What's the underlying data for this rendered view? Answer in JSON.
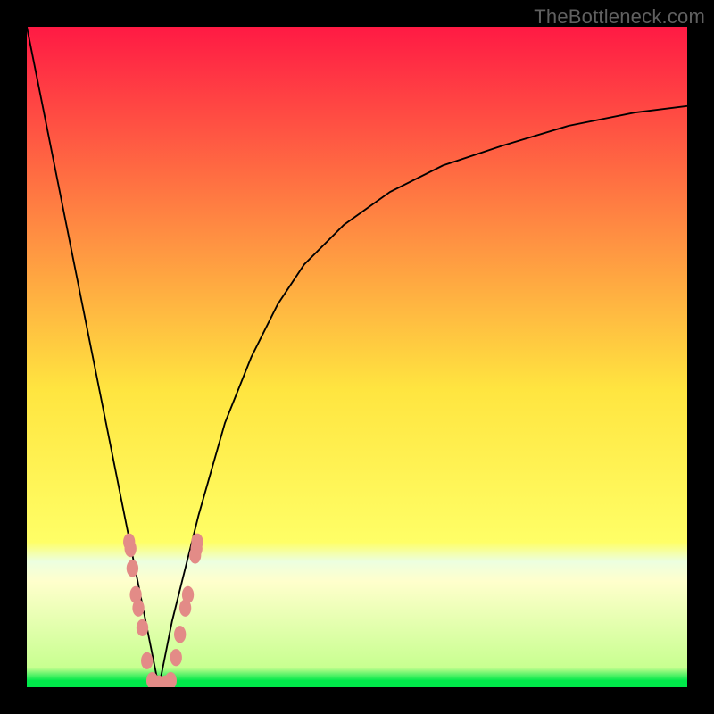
{
  "watermark": "TheBottleneck.com",
  "colors": {
    "bg_black": "#000000",
    "grad_top": "#ff1a44",
    "grad_mid": "#ffe540",
    "grad_bottom_strip": "#ecffe0",
    "grad_green": "#00e84a",
    "marker_fill": "#e38b87",
    "curve": "#000000"
  },
  "chart_data": {
    "type": "line",
    "title": "",
    "xlabel": "",
    "ylabel": "",
    "xlim": [
      0,
      100
    ],
    "ylim": [
      0,
      100
    ],
    "x_min_pt": 20,
    "curve_left": {
      "x": [
        0,
        2,
        4,
        6,
        8,
        10,
        12,
        14,
        16,
        17,
        18,
        19,
        20
      ],
      "y": [
        100,
        90,
        80,
        70,
        60,
        50,
        40,
        30,
        20,
        15,
        10,
        5,
        0
      ]
    },
    "curve_right": {
      "x": [
        20,
        21,
        22,
        24,
        26,
        28,
        30,
        34,
        38,
        42,
        48,
        55,
        63,
        72,
        82,
        92,
        100
      ],
      "y": [
        0,
        5,
        10,
        18,
        26,
        33,
        40,
        50,
        58,
        64,
        70,
        75,
        79,
        82,
        85,
        87,
        88
      ]
    },
    "markers": [
      {
        "x": 15.5,
        "y": 22
      },
      {
        "x": 15.7,
        "y": 21
      },
      {
        "x": 16.0,
        "y": 18
      },
      {
        "x": 16.5,
        "y": 14
      },
      {
        "x": 16.9,
        "y": 12
      },
      {
        "x": 17.5,
        "y": 9
      },
      {
        "x": 18.2,
        "y": 4
      },
      {
        "x": 19.0,
        "y": 1
      },
      {
        "x": 20.0,
        "y": 0.5
      },
      {
        "x": 21.0,
        "y": 0.5
      },
      {
        "x": 21.8,
        "y": 1
      },
      {
        "x": 22.6,
        "y": 4.5
      },
      {
        "x": 23.2,
        "y": 8
      },
      {
        "x": 24.0,
        "y": 12
      },
      {
        "x": 24.4,
        "y": 14
      },
      {
        "x": 25.5,
        "y": 20
      },
      {
        "x": 25.7,
        "y": 21
      },
      {
        "x": 25.8,
        "y": 22
      }
    ],
    "marker_rx": 0.9,
    "marker_ry": 1.3
  }
}
